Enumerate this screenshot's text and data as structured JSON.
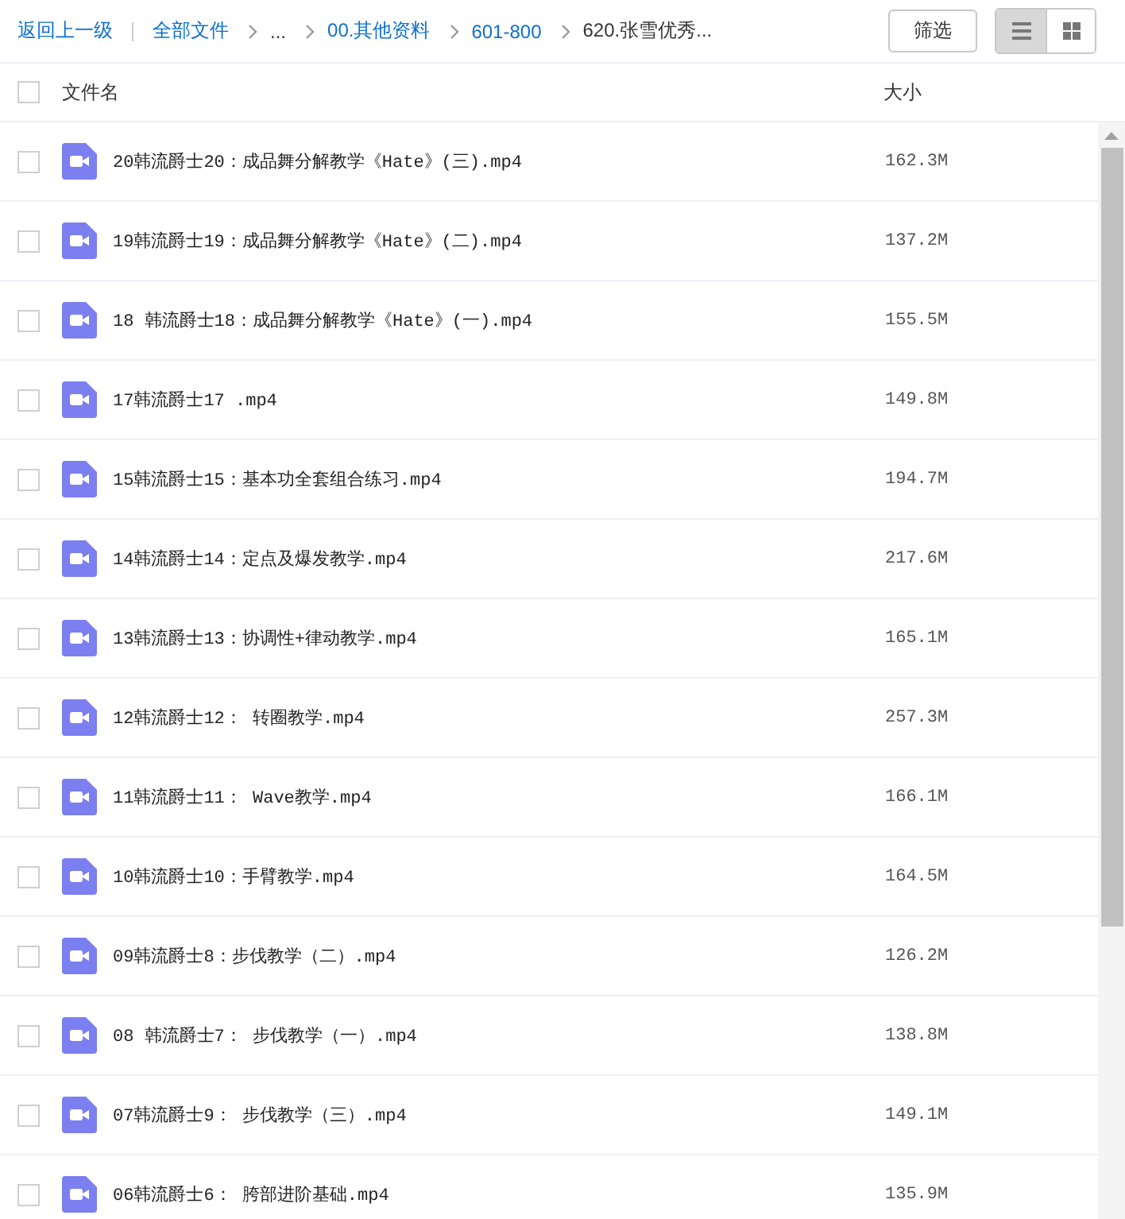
{
  "toolbar": {
    "back_link": "返回上一级",
    "breadcrumbs": [
      {
        "label": "全部文件",
        "link": true
      },
      {
        "label": "...",
        "link": false
      },
      {
        "label": "00.其他资料",
        "link": true
      },
      {
        "label": "601-800",
        "link": true
      },
      {
        "label": "620.张雪优秀...",
        "link": false
      }
    ],
    "filter_button": "筛选",
    "view_modes": [
      {
        "kind": "list",
        "selected": true
      },
      {
        "kind": "grid",
        "selected": false
      }
    ]
  },
  "table": {
    "header_checked": false,
    "columns": [
      "文件名",
      "大小"
    ],
    "rows": [
      {
        "name": "20韩流爵士20：成品舞分解教学《Hate》(三).mp4",
        "size": "162.3M",
        "checked": false
      },
      {
        "name": "19韩流爵士19：成品舞分解教学《Hate》(二).mp4",
        "size": "137.2M",
        "checked": false
      },
      {
        "name": "18 韩流爵士18：成品舞分解教学《Hate》(一).mp4",
        "size": "155.5M",
        "checked": false
      },
      {
        "name": "17韩流爵士17 .mp4",
        "size": "149.8M",
        "checked": false
      },
      {
        "name": "15韩流爵士15：基本功全套组合练习.mp4",
        "size": "194.7M",
        "checked": false
      },
      {
        "name": "14韩流爵士14：定点及爆发教学.mp4",
        "size": "217.6M",
        "checked": false
      },
      {
        "name": "13韩流爵士13：协调性+律动教学.mp4",
        "size": "165.1M",
        "checked": false
      },
      {
        "name": "12韩流爵士12： 转圈教学.mp4",
        "size": "257.3M",
        "checked": false
      },
      {
        "name": "11韩流爵士11： Wave教学.mp4",
        "size": "166.1M",
        "checked": false
      },
      {
        "name": "10韩流爵士10：手臂教学.mp4",
        "size": "164.5M",
        "checked": false
      },
      {
        "name": "09韩流爵士8：步伐教学（二）.mp4",
        "size": "126.2M",
        "checked": false
      },
      {
        "name": "08 韩流爵士7： 步伐教学（一）.mp4",
        "size": "138.8M",
        "checked": false
      },
      {
        "name": "07韩流爵士9： 步伐教学（三）.mp4",
        "size": "149.1M",
        "checked": false
      },
      {
        "name": "06韩流爵士6： 胯部进阶基础.mp4",
        "size": "135.9M",
        "checked": false
      }
    ]
  }
}
